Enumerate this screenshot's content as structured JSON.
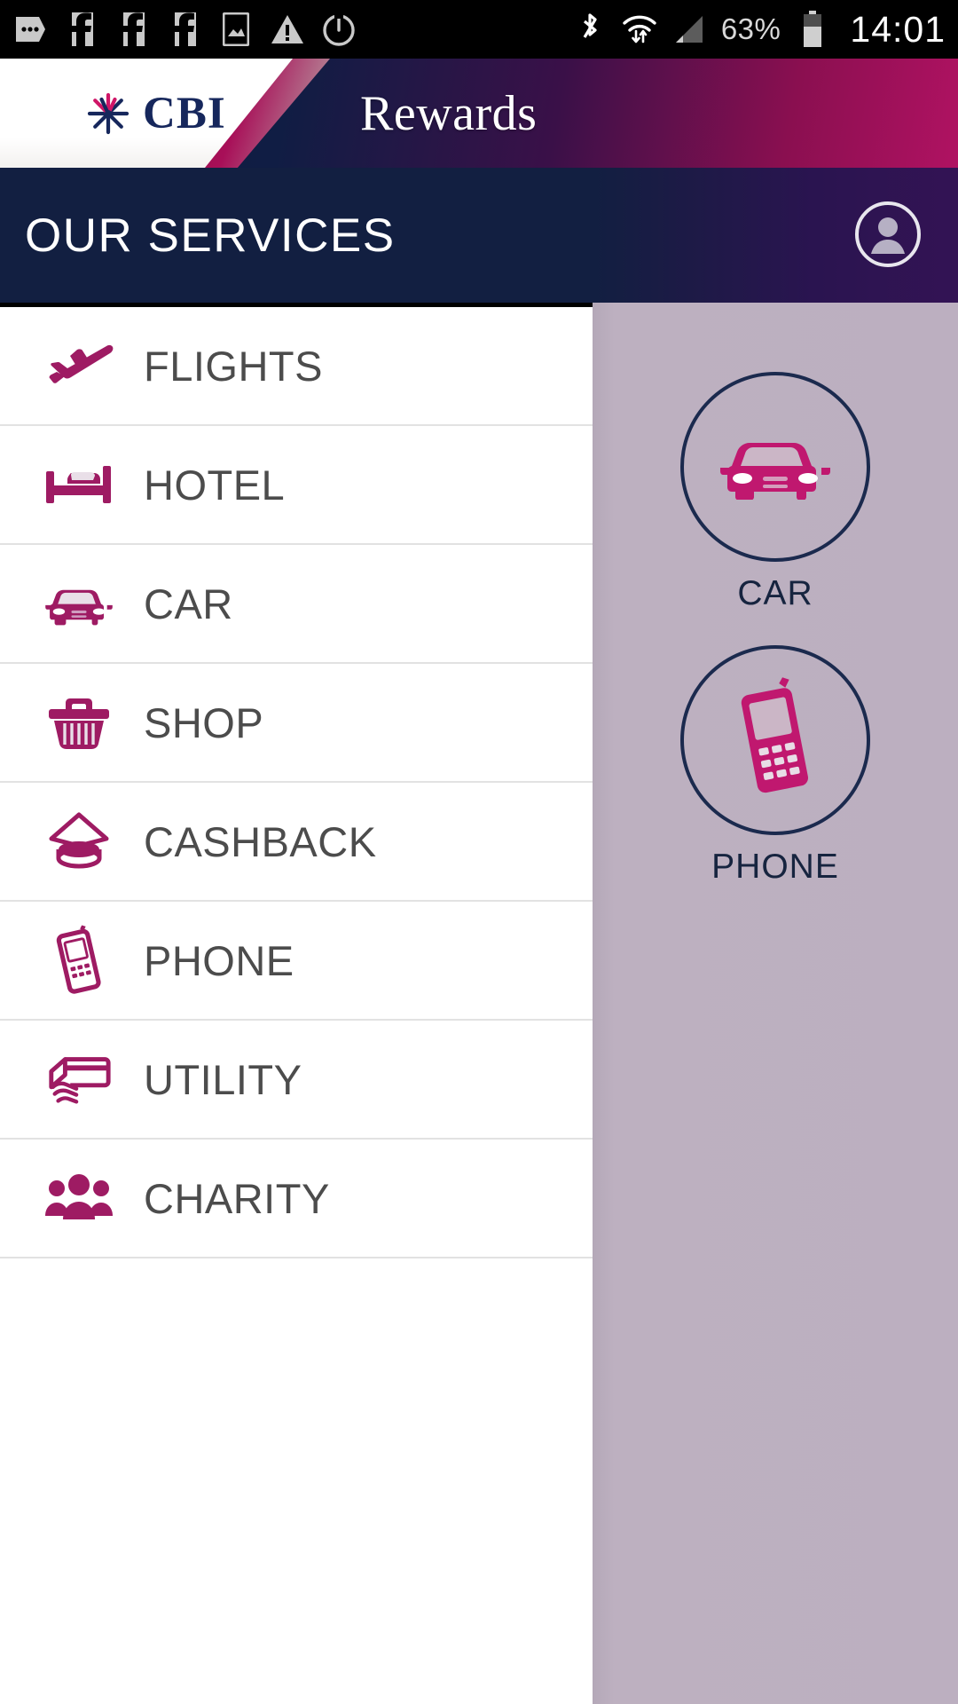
{
  "status_bar": {
    "icons": [
      "messages-icon",
      "facebook-icon",
      "facebook-icon",
      "facebook-icon",
      "screenshot-icon",
      "warning-icon",
      "alarm-icon"
    ],
    "right_icons": [
      "bluetooth-icon",
      "wifi-icon",
      "signal-icon"
    ],
    "battery_percent": "63%",
    "battery_icon": "battery-icon",
    "time": "14:01"
  },
  "header": {
    "logo_text": "CBI",
    "logo_icon": "cbi-starburst-logo",
    "title": "Rewards",
    "navy": "#121f41",
    "magenta": "#b01262"
  },
  "services": {
    "heading": "OUR SERVICES",
    "avatar_icon": "user-avatar-icon",
    "items": [
      {
        "label": "FLIGHTS",
        "icon": "airplane-icon"
      },
      {
        "label": "HOTEL",
        "icon": "bed-icon"
      },
      {
        "label": "CAR",
        "icon": "car-icon"
      },
      {
        "label": "SHOP",
        "icon": "shopping-basket-icon"
      },
      {
        "label": "CASHBACK",
        "icon": "coin-stack-icon"
      },
      {
        "label": "PHONE",
        "icon": "mobile-phone-icon"
      },
      {
        "label": "UTILITY",
        "icon": "hand-card-icon"
      },
      {
        "label": "CHARITY",
        "icon": "people-group-icon"
      }
    ]
  },
  "background_panel": {
    "accent": "#c0186f",
    "tiles": [
      {
        "label": "CAR",
        "icon": "car-icon"
      },
      {
        "label": "PHONE",
        "icon": "mobile-phone-icon"
      }
    ]
  }
}
